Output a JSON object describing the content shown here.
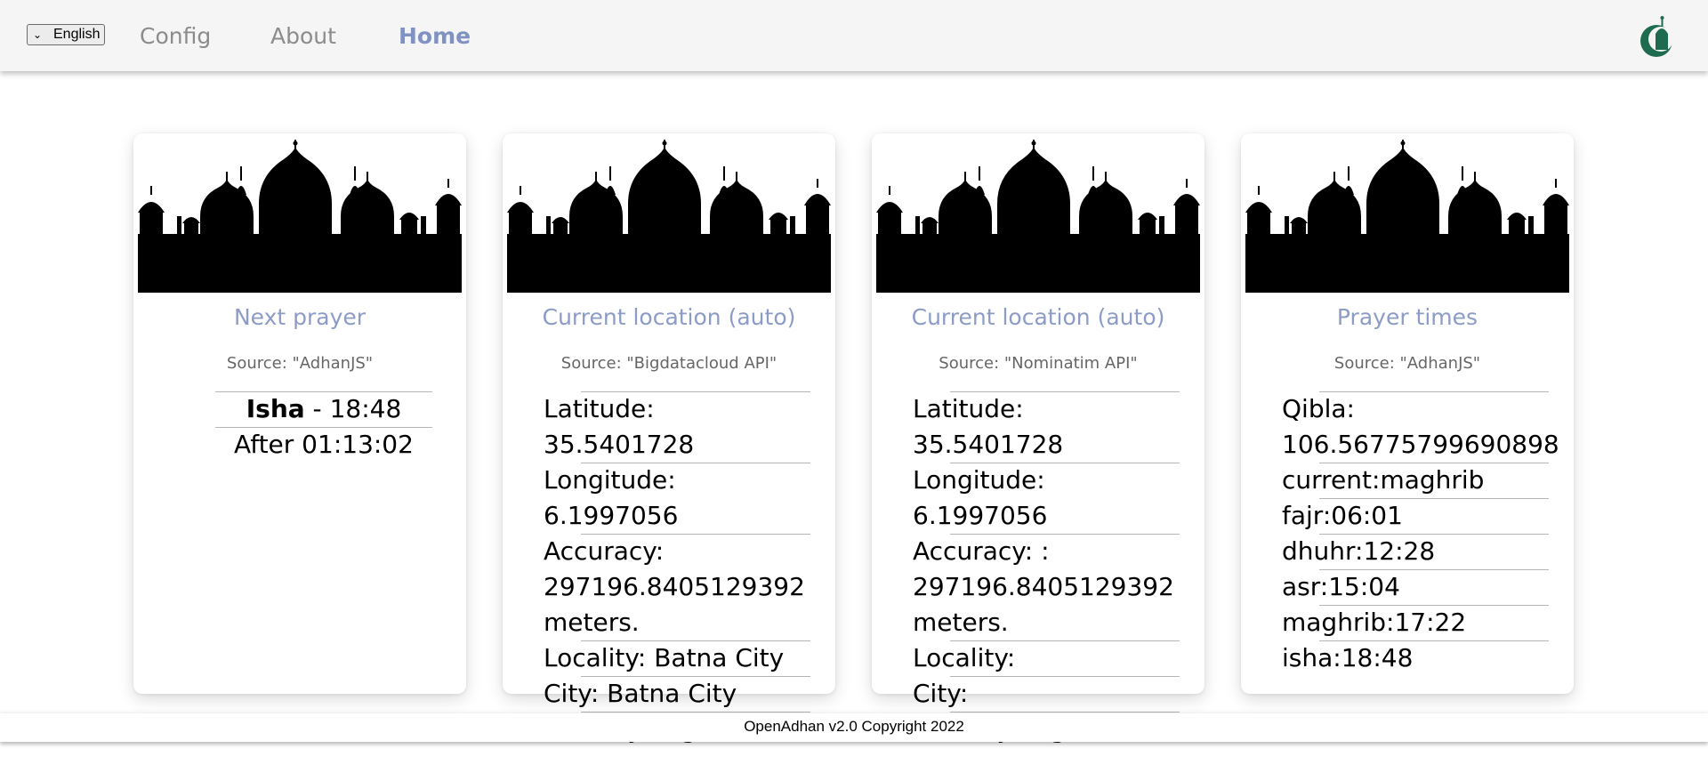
{
  "nav": {
    "language": "English",
    "links": [
      "Config",
      "About",
      "Home"
    ],
    "active": "Home",
    "accent_color": "#8092c2",
    "logo_icon": "mosque-logo-icon"
  },
  "cards": {
    "next_prayer": {
      "title": "Next prayer",
      "source": "Source: \"AdhanJS\"",
      "prayer_name": "Isha",
      "prayer_sep": " - ",
      "prayer_time": "18:48",
      "countdown": "After 01:13:02"
    },
    "location_auto_1": {
      "title": "Current location (auto)",
      "source": "Source: \"Bigdatacloud API\"",
      "latitude": "Latitude: 35.5401728",
      "longitude": "Longitude: 6.1997056",
      "accuracy_label": "Accuracy:",
      "accuracy_value": "297196.8405129392",
      "accuracy_unit": "meters.",
      "locality": "Locality: Batna City",
      "city": "City: Batna City",
      "country": "Country: Algeria"
    },
    "location_auto_2": {
      "title": "Current location (auto)",
      "source": "Source: \"Nominatim API\"",
      "latitude": "Latitude: 35.5401728",
      "longitude": "Longitude: 6.1997056",
      "accuracy_label": "Accuracy: :",
      "accuracy_value": "297196.8405129392",
      "accuracy_unit": "meters.",
      "locality": "Locality:",
      "city": "City:",
      "country": "Country: Algeria"
    },
    "prayer_times": {
      "title": "Prayer times",
      "source": "Source: \"AdhanJS\"",
      "qibla_label": "Qibla:",
      "qibla_value": "106.56775799690898",
      "current": "current:maghrib",
      "fajr": "fajr:06:01",
      "dhuhr": "dhuhr:12:28",
      "asr": "asr:15:04",
      "maghrib": "maghrib:17:22",
      "isha": "isha:18:48"
    }
  },
  "footer": {
    "text": "OpenAdhan v2.0 Copyright 2022"
  }
}
